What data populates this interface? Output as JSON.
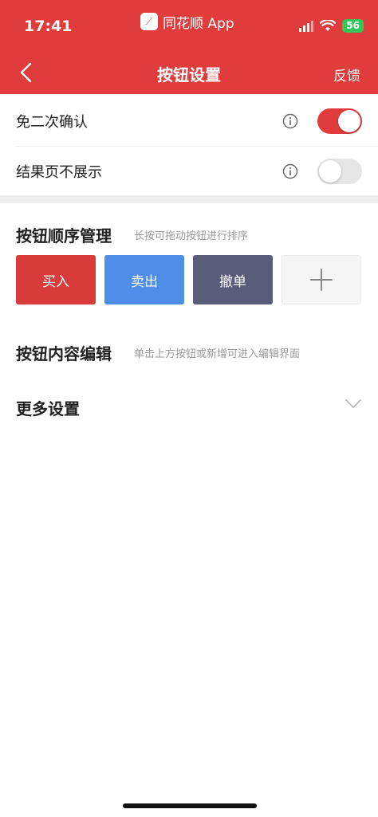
{
  "status_bar": {
    "time": "17:41",
    "app_name": "同花顺 App",
    "app_icon_glyph": "⟋",
    "battery": "56"
  },
  "nav": {
    "title": "按钮设置",
    "feedback": "反馈"
  },
  "settings": [
    {
      "label": "免二次确认",
      "enabled": true
    },
    {
      "label": "结果页不展示",
      "enabled": false
    }
  ],
  "order_section": {
    "title": "按钮顺序管理",
    "hint": "长按可拖动按钮进行排序",
    "buttons": [
      {
        "label": "买入",
        "color": "#d93a3a"
      },
      {
        "label": "卖出",
        "color": "#4f8ee8"
      },
      {
        "label": "撤单",
        "color": "#5a5d7a"
      }
    ],
    "add_glyph": "+"
  },
  "content_section": {
    "title": "按钮内容编辑",
    "hint": "单击上方按钮或新增可进入编辑界面"
  },
  "more_settings": {
    "title": "更多设置"
  },
  "colors": {
    "brand_red": "#e03c3c",
    "toggle_on": "#e03c3c",
    "toggle_off": "#e6e6e6"
  }
}
